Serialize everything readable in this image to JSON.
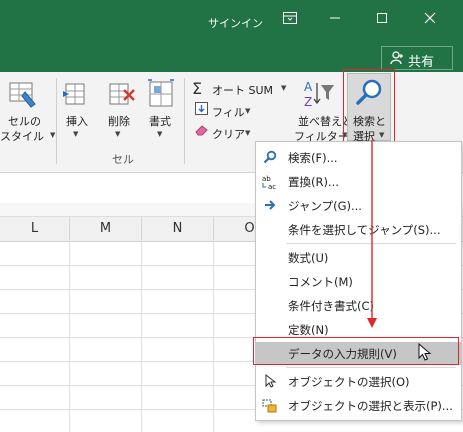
{
  "titlebar": {
    "signin": "サインイン",
    "icons": [
      "ribbon-display-options-icon",
      "minimize-icon",
      "maximize-icon",
      "close-icon"
    ]
  },
  "share": {
    "label": "共有",
    "icon": "person-icon"
  },
  "ribbon": {
    "cell_style": {
      "line1": "セルの",
      "line2": "スタイル"
    },
    "insert": "挿入",
    "delete": "削除",
    "format": "書式",
    "cells_group": "セル",
    "autosum": "オート SUM",
    "fill": "フィル",
    "clear": "クリア",
    "sort_filter": {
      "line1": "並べ替えと",
      "line2": "フィルター"
    },
    "find_select": {
      "line1": "検索と",
      "line2": "選択"
    }
  },
  "grid": {
    "columns": [
      "L",
      "M",
      "N",
      "O"
    ]
  },
  "menu": {
    "items": [
      {
        "label": "検索(F)...",
        "icon": "search-icon"
      },
      {
        "label": "置換(R)...",
        "icon": "replace-icon"
      },
      {
        "label": "ジャンプ(G)...",
        "icon": "arrow-right-icon"
      },
      {
        "label": "条件を選択してジャンプ(S)..."
      },
      {
        "label": "数式(U)"
      },
      {
        "label": "コメント(M)"
      },
      {
        "label": "条件付き書式(C)"
      },
      {
        "label": "定数(N)"
      },
      {
        "label": "データの入力規則(V)"
      },
      {
        "label": "オブジェクトの選択(O)",
        "icon": "pointer-icon"
      },
      {
        "label": "オブジェクトの選択と表示(P)...",
        "icon": "selection-pane-icon"
      }
    ],
    "highlighted": "データの入力規則(V)"
  },
  "annotation": {
    "arrow_color": "#e0262b",
    "highlight_color": "#e0262b"
  }
}
